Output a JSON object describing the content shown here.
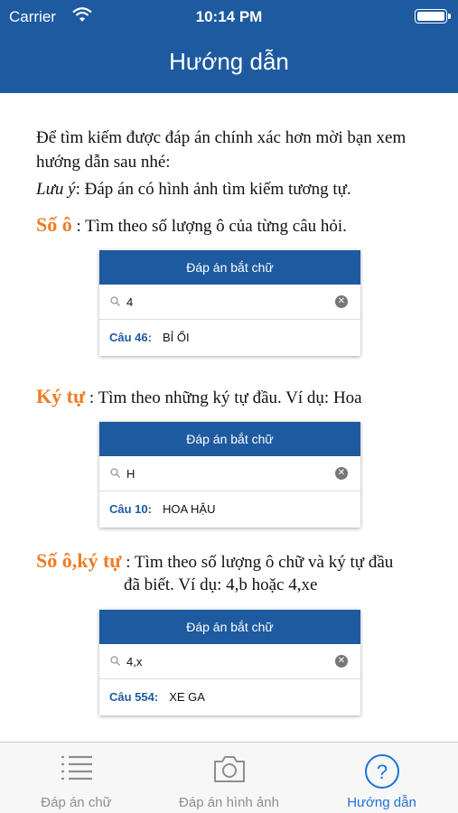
{
  "status_bar": {
    "carrier": "Carrier",
    "time": "10:14 PM"
  },
  "header": {
    "title": "Hướng dẫn"
  },
  "intro": {
    "text": "Để tìm kiếm được đáp án chính xác hơn mời bạn xem hướng dẫn sau nhé:",
    "note_label": "Lưu ý",
    "note_text": ": Đáp án có hình ảnh tìm kiếm tương tự."
  },
  "sections": [
    {
      "keyword": "Số ô",
      "desc": " :  Tìm theo số lượng ô của từng câu hỏi.",
      "demo": {
        "header": "Đáp án bắt chữ",
        "query": "4",
        "question": "Câu 46:",
        "answer": "BỈ ỔI"
      }
    },
    {
      "keyword": "Ký tự",
      "desc": " :  Tìm theo những ký tự đầu. Ví dụ: Hoa",
      "demo": {
        "header": "Đáp án bắt chữ",
        "query": "H",
        "question": "Câu 10:",
        "answer": "HOA HẬU"
      }
    },
    {
      "keyword": "Số ô,ký tự",
      "desc_line1": " :  Tìm theo số lượng ô chữ và ký tự đầu",
      "desc_line2": "đã biết. Ví dụ: 4,b hoặc 4,xe",
      "demo": {
        "header": "Đáp án bắt chữ",
        "query": "4,x",
        "question": "Câu 554:",
        "answer": "XE GA"
      }
    }
  ],
  "tabbar": {
    "tabs": [
      {
        "label": "Đáp án chữ",
        "icon": "list-icon"
      },
      {
        "label": "Đáp án hình ảnh",
        "icon": "camera-icon"
      },
      {
        "label": "Hướng dẫn",
        "icon": "help-icon"
      }
    ],
    "active_color": "#1a73d9"
  },
  "colors": {
    "brand": "#1d5aa0",
    "keyword": "#f07b22"
  }
}
